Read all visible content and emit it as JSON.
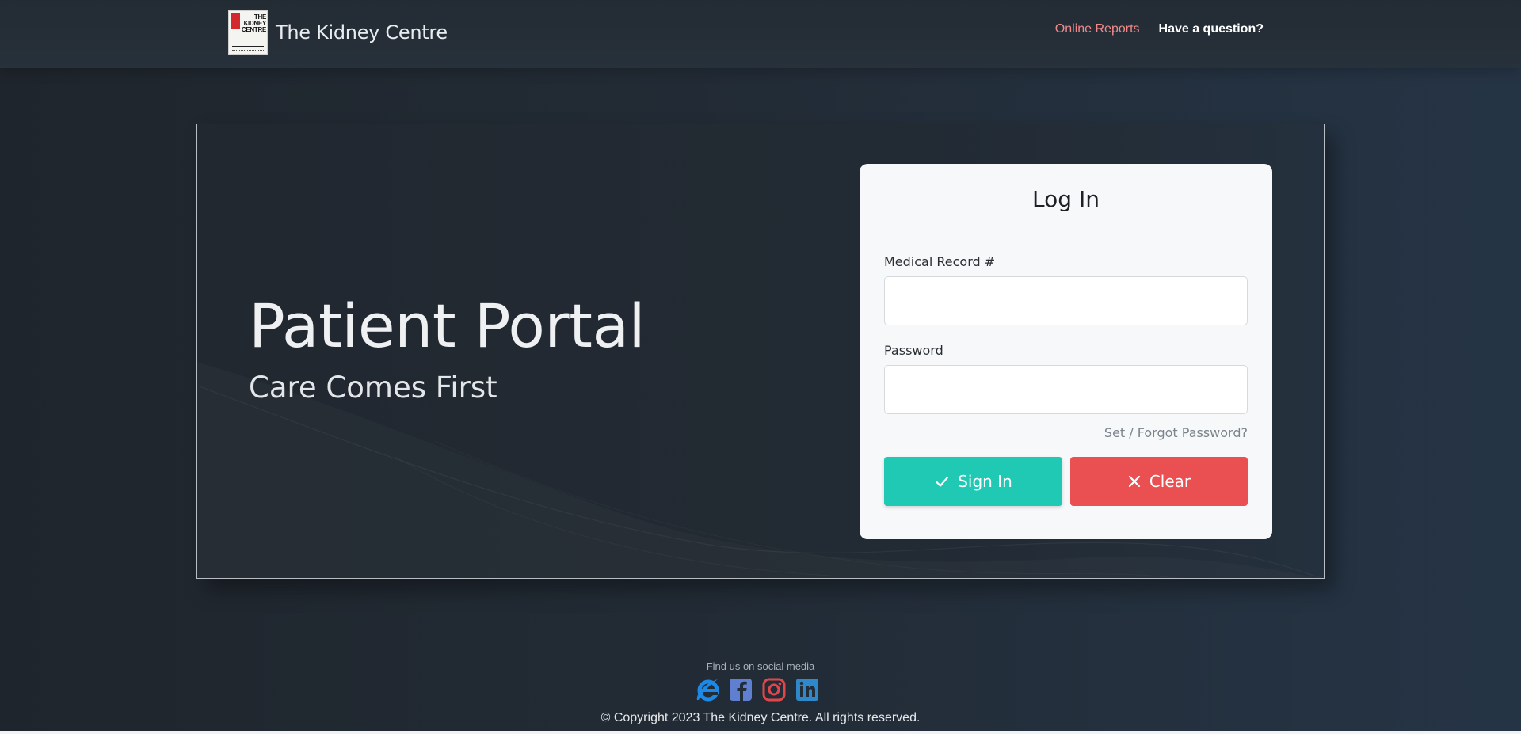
{
  "header": {
    "logo_text": "THE KIDNEY CENTRE",
    "brand_name": "The Kidney Centre",
    "nav": [
      {
        "label": "Online Reports"
      },
      {
        "label": "Have a question?"
      }
    ]
  },
  "hero": {
    "title": "Patient Portal",
    "subtitle": "Care Comes First"
  },
  "login": {
    "title": "Log In",
    "mrn_label": "Medical Record #",
    "mrn_value": "",
    "password_label": "Password",
    "password_value": "",
    "forgot_label": "Set / Forgot Password?",
    "sign_in_label": "Sign In",
    "clear_label": "Clear"
  },
  "footer": {
    "social_label": "Find us on social media",
    "social_icons": [
      "internet-explorer-icon",
      "facebook-icon",
      "instagram-icon",
      "linkedin-icon"
    ],
    "copyright": "© Copyright 2023 The Kidney Centre. All rights reserved."
  },
  "colors": {
    "sign_in": "#1fc9b4",
    "clear": "#ea4f52",
    "active_nav": "#f08a8a",
    "background": "#222a33"
  }
}
